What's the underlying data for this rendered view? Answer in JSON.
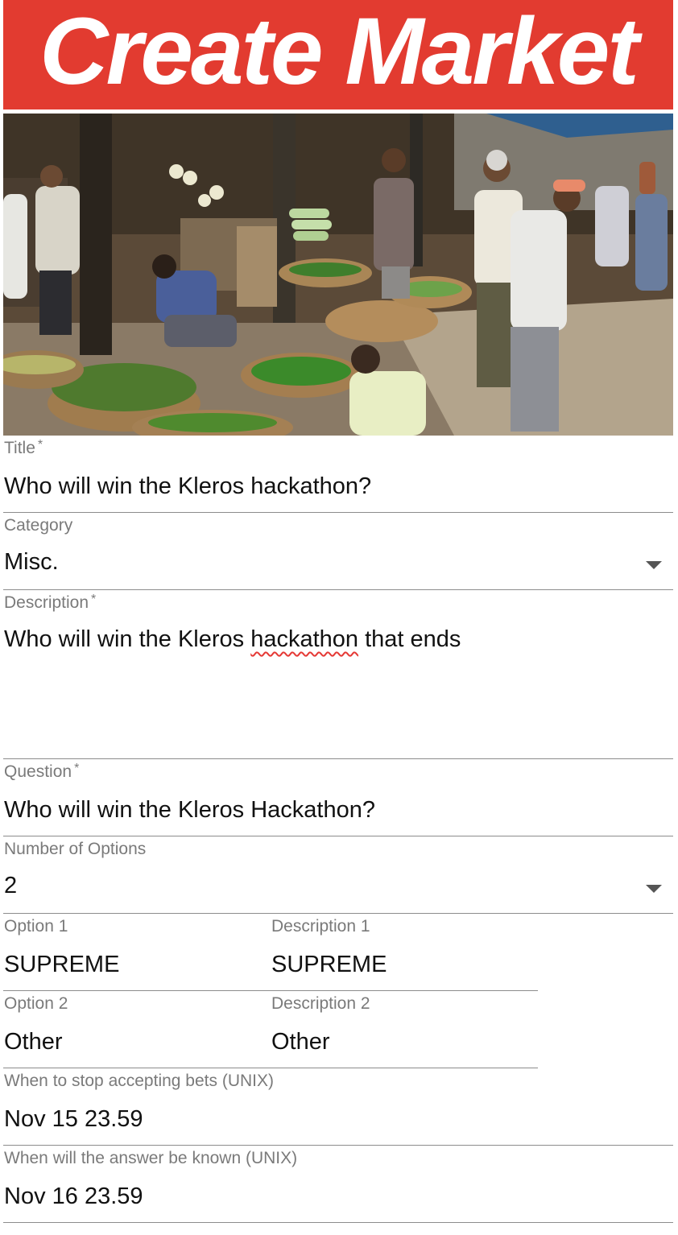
{
  "banner": {
    "title": "Create Market",
    "color": "#e23b30"
  },
  "hero_image": {
    "description_icon": "market-photo"
  },
  "form": {
    "title": {
      "label": "Title",
      "required_mark": "*",
      "value": "Who will win the Kleros hackathon?"
    },
    "category": {
      "label": "Category",
      "value": "Misc.",
      "icon": "caret-down-icon"
    },
    "description": {
      "label": "Description",
      "required_mark": "*",
      "value_before": "Who will win the Kleros ",
      "value_misspelled": "hackathon",
      "value_after": " that ends"
    },
    "question": {
      "label": "Question",
      "required_mark": "*",
      "value": "Who will win the Kleros Hackathon?"
    },
    "num_options": {
      "label": "Number of Options",
      "value": "2",
      "icon": "caret-down-icon"
    },
    "options": [
      {
        "option_label": "Option 1",
        "option_value": "SUPREME",
        "desc_label": "Description 1",
        "desc_value": "SUPREME"
      },
      {
        "option_label": "Option 2",
        "option_value": "Other",
        "desc_label": "Description 2",
        "desc_value": "Other"
      }
    ],
    "stop_bets": {
      "label": "When to stop accepting bets (UNIX)",
      "value": "Nov 15 23.59"
    },
    "answer_known": {
      "label": "When will the answer be known (UNIX)",
      "value": "Nov 16 23.59"
    }
  }
}
